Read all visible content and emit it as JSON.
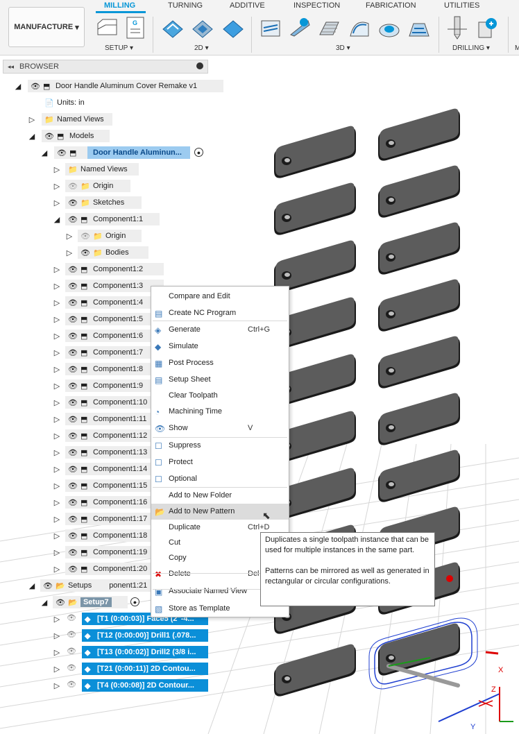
{
  "toolbar": {
    "workspace_label": "MANUFACTURE",
    "tabs": [
      "MILLING",
      "TURNING",
      "ADDITIVE",
      "INSPECTION",
      "FABRICATION",
      "UTILITIES"
    ],
    "groups": [
      "SETUP",
      "2D",
      "3D",
      "DRILLING",
      "M"
    ]
  },
  "browser": {
    "title": "BROWSER",
    "root": "Door Handle Aluminum Cover Remake v1",
    "units": "Units: in",
    "named_views": "Named Views",
    "models": "Models",
    "model_root": "Door Handle Aluminun...",
    "children": [
      "Named Views",
      "Origin",
      "Sketches",
      "Component1:1"
    ],
    "sub_children": [
      "Origin",
      "Bodies"
    ],
    "components": [
      "Component1:2",
      "Component1:3",
      "Component1:4",
      "Component1:5",
      "Component1:6",
      "Component1:7",
      "Component1:8",
      "Component1:9",
      "Component1:10",
      "Component1:11",
      "Component1:12",
      "Component1:13",
      "Component1:14",
      "Component1:15",
      "Component1:16",
      "Component1:17",
      "Component1:18",
      "Component1:19",
      "Component1:20",
      "Component1:21"
    ],
    "setups": "Setups",
    "setup": "Setup7",
    "operations": [
      "[T1 (0:00:03)] Face5 (2\"-4...",
      "[T12 (0:00:00)] Drill1 (.078...",
      "[T13 (0:00:02)] Drill2 (3/8 i...",
      "[T21 (0:00:11)] 2D Contou...",
      "[T4 (0:00:08)] 2D Contour..."
    ]
  },
  "context_menu": {
    "items": [
      {
        "label": "Compare and Edit",
        "shortcut": ""
      },
      {
        "label": "Create NC Program",
        "shortcut": ""
      },
      {
        "label": "Generate",
        "shortcut": "Ctrl+G"
      },
      {
        "label": "Simulate",
        "shortcut": ""
      },
      {
        "label": "Post Process",
        "shortcut": ""
      },
      {
        "label": "Setup Sheet",
        "shortcut": ""
      },
      {
        "label": "Clear Toolpath",
        "shortcut": ""
      },
      {
        "label": "Machining Time",
        "shortcut": ""
      },
      {
        "label": "Show",
        "shortcut": "V"
      },
      {
        "label": "Suppress",
        "shortcut": ""
      },
      {
        "label": "Protect",
        "shortcut": ""
      },
      {
        "label": "Optional",
        "shortcut": ""
      },
      {
        "label": "Add to New Folder",
        "shortcut": ""
      },
      {
        "label": "Add to New Pattern",
        "shortcut": ""
      },
      {
        "label": "Duplicate",
        "shortcut": "Ctrl+D"
      },
      {
        "label": "Cut",
        "shortcut": ""
      },
      {
        "label": "Copy",
        "shortcut": ""
      },
      {
        "label": "Delete",
        "shortcut": "Del"
      },
      {
        "label": "Associate Named View",
        "shortcut": ""
      },
      {
        "label": "Store as Template",
        "shortcut": ""
      }
    ]
  },
  "tooltip": {
    "line1": "Duplicates a single toolpath instance that can be used for multiple instances in the same part.",
    "line2": "Patterns can be mirrored as well as generated in rectangular or circular configurations."
  },
  "viewcube": {
    "x": "X",
    "y": "Y",
    "z": "Z"
  },
  "colors": {
    "accent": "#0696d7",
    "selected": "#9ccbf0",
    "operation": "#0b8fd8",
    "part": "#5a5a5a"
  }
}
